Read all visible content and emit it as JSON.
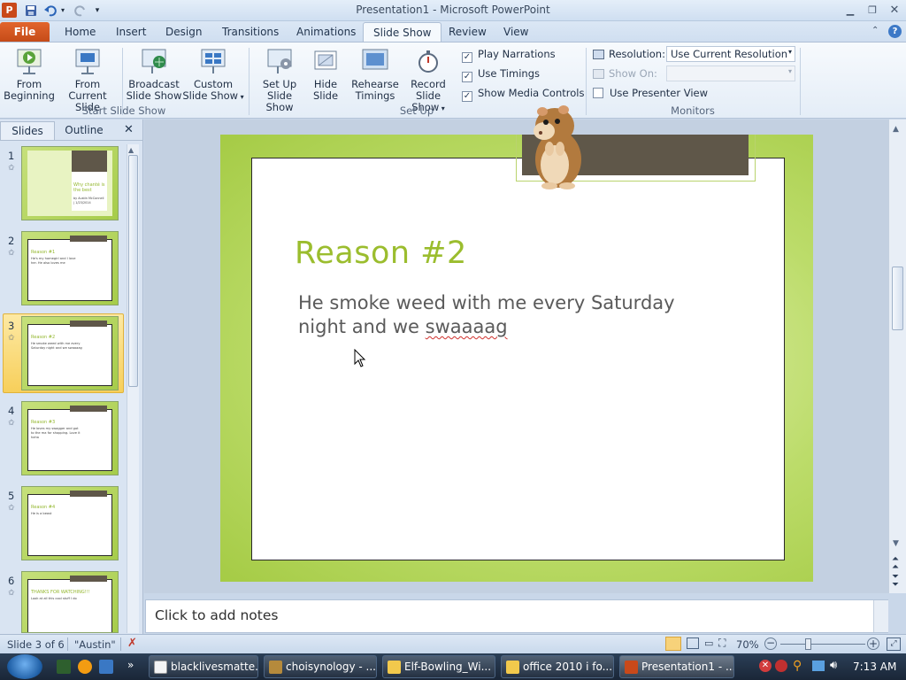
{
  "window": {
    "title": "Presentation1 - Microsoft PowerPoint"
  },
  "tabs": [
    {
      "label": "File"
    },
    {
      "label": "Home"
    },
    {
      "label": "Insert"
    },
    {
      "label": "Design"
    },
    {
      "label": "Transitions"
    },
    {
      "label": "Animations"
    },
    {
      "label": "Slide Show"
    },
    {
      "label": "Review"
    },
    {
      "label": "View"
    }
  ],
  "ribbon": {
    "start": {
      "group_label": "Start Slide Show",
      "from_beginning": [
        "From",
        "Beginning"
      ],
      "from_current": [
        "From",
        "Current Slide"
      ],
      "broadcast": [
        "Broadcast",
        "Slide Show"
      ],
      "custom": [
        "Custom",
        "Slide Show"
      ]
    },
    "setup": {
      "group_label": "Set Up",
      "setup_show": [
        "Set Up",
        "Slide Show"
      ],
      "hide_slide": [
        "Hide",
        "Slide"
      ],
      "rehearse": [
        "Rehearse",
        "Timings"
      ],
      "record": [
        "Record Slide",
        "Show"
      ],
      "play_narrations": "Play Narrations",
      "use_timings": "Use Timings",
      "show_media_controls": "Show Media Controls"
    },
    "monitors": {
      "group_label": "Monitors",
      "resolution_label": "Resolution:",
      "resolution_value": "Use Current Resolution",
      "show_on_label": "Show On:",
      "presenter_view": "Use Presenter View"
    }
  },
  "leftpane": {
    "tabs": [
      "Slides",
      "Outline"
    ],
    "slides": [
      {
        "num": "1",
        "title": "Why chanté is the best",
        "body": "by Austin McConnell | 1/23/2014"
      },
      {
        "num": "2",
        "title": "Reason #1",
        "body": "He's my homegirl and I love her. He also loves me"
      },
      {
        "num": "3",
        "title": "Reason #2",
        "body": "He smoke weed with me every Saturday night and we swaaaag"
      },
      {
        "num": "4",
        "title": "Reason #3",
        "body": "He loves my swagger and got to the ma for shopping. Love it haha"
      },
      {
        "num": "5",
        "title": "Reason #4",
        "body": "He is a beast"
      },
      {
        "num": "6",
        "title": "THANKS FOR WATCHING!!!",
        "body": "Look at all this cool stuff I do"
      }
    ]
  },
  "slide": {
    "title": "Reason #2",
    "body_line1": "He smoke weed with me every Saturday",
    "body_line2_pre": "night and we ",
    "body_line2_word": "swaaaag"
  },
  "notes": {
    "placeholder": "Click to add notes"
  },
  "status": {
    "slide_of": "Slide 3 of 6",
    "theme": "\"Austin\"",
    "zoom": "70%"
  },
  "taskbar": {
    "items": [
      {
        "label": "blacklivesmatte..."
      },
      {
        "label": "choisynology - ..."
      },
      {
        "label": "Elf-Bowling_Wi..."
      },
      {
        "label": "office 2010 i fo..."
      },
      {
        "label": "Presentation1 - ..."
      }
    ],
    "clock": "7:13 AM"
  },
  "colors": {
    "accent": "#c44a17",
    "slide_title": "#9bbd2e",
    "slide_frame": "#a5cb45",
    "bar": "#5f5749"
  }
}
